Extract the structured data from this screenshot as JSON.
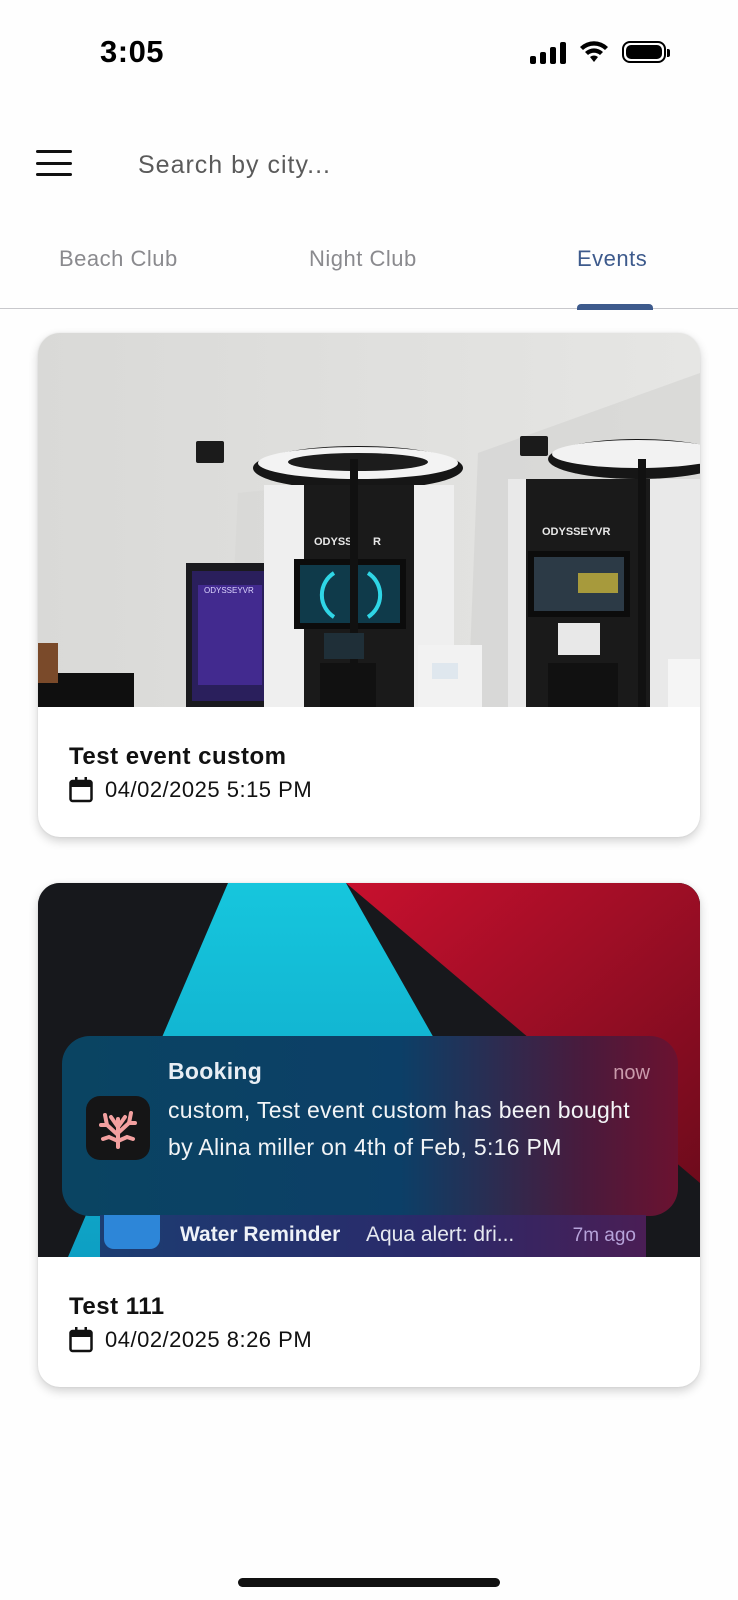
{
  "status_bar": {
    "time": "3:05"
  },
  "header": {
    "search_placeholder": "Search by city..."
  },
  "tabs": [
    {
      "label": "Beach Club",
      "active": false
    },
    {
      "label": "Night Club",
      "active": false
    },
    {
      "label": "Events",
      "active": true
    }
  ],
  "colors": {
    "accent": "#3d5a8c",
    "tab_inactive": "#8a8a8e"
  },
  "events": [
    {
      "title": "Test event custom",
      "date": "04/02/2025 5:15 PM",
      "image": {
        "scene": "vr-arcade",
        "screen_labels": [
          "ODYSSEYVR",
          "ODYSS",
          "R",
          "ODYSSEYVR"
        ]
      }
    },
    {
      "title": "Test 111",
      "date": "04/02/2025 8:26 PM",
      "image": {
        "scene": "notification-screenshot",
        "notification": {
          "title": "Booking",
          "time": "now",
          "body": "custom, Test event custom has been bought by Alina miller on 4th of Feb, 5:16 PM"
        },
        "notification_secondary": {
          "title": "Water Reminder",
          "text": "Aqua alert: dri...",
          "time": "7m ago"
        }
      }
    }
  ]
}
